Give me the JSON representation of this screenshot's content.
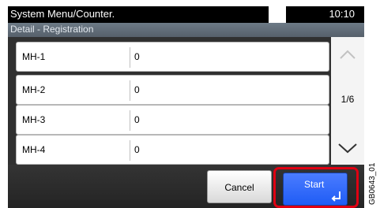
{
  "header": {
    "title": "System Menu/Counter.",
    "time": "10:10"
  },
  "subheader": {
    "title": "Detail - Registration"
  },
  "rows": [
    {
      "name": "MH-1",
      "value": "0"
    },
    {
      "name": "MH-2",
      "value": "0"
    },
    {
      "name": "MH-3",
      "value": "0"
    },
    {
      "name": "MH-4",
      "value": "0"
    }
  ],
  "pager": {
    "page": "1/6"
  },
  "buttons": {
    "cancel": "Cancel",
    "start": "Start"
  },
  "figure_code": "GB0643_01",
  "icons": {
    "scroll_up": "chevron-up-icon",
    "scroll_down": "chevron-down-icon",
    "enter": "enter-arrow-icon"
  },
  "colors": {
    "accent": "#2563f7",
    "highlight": "#e00012"
  }
}
